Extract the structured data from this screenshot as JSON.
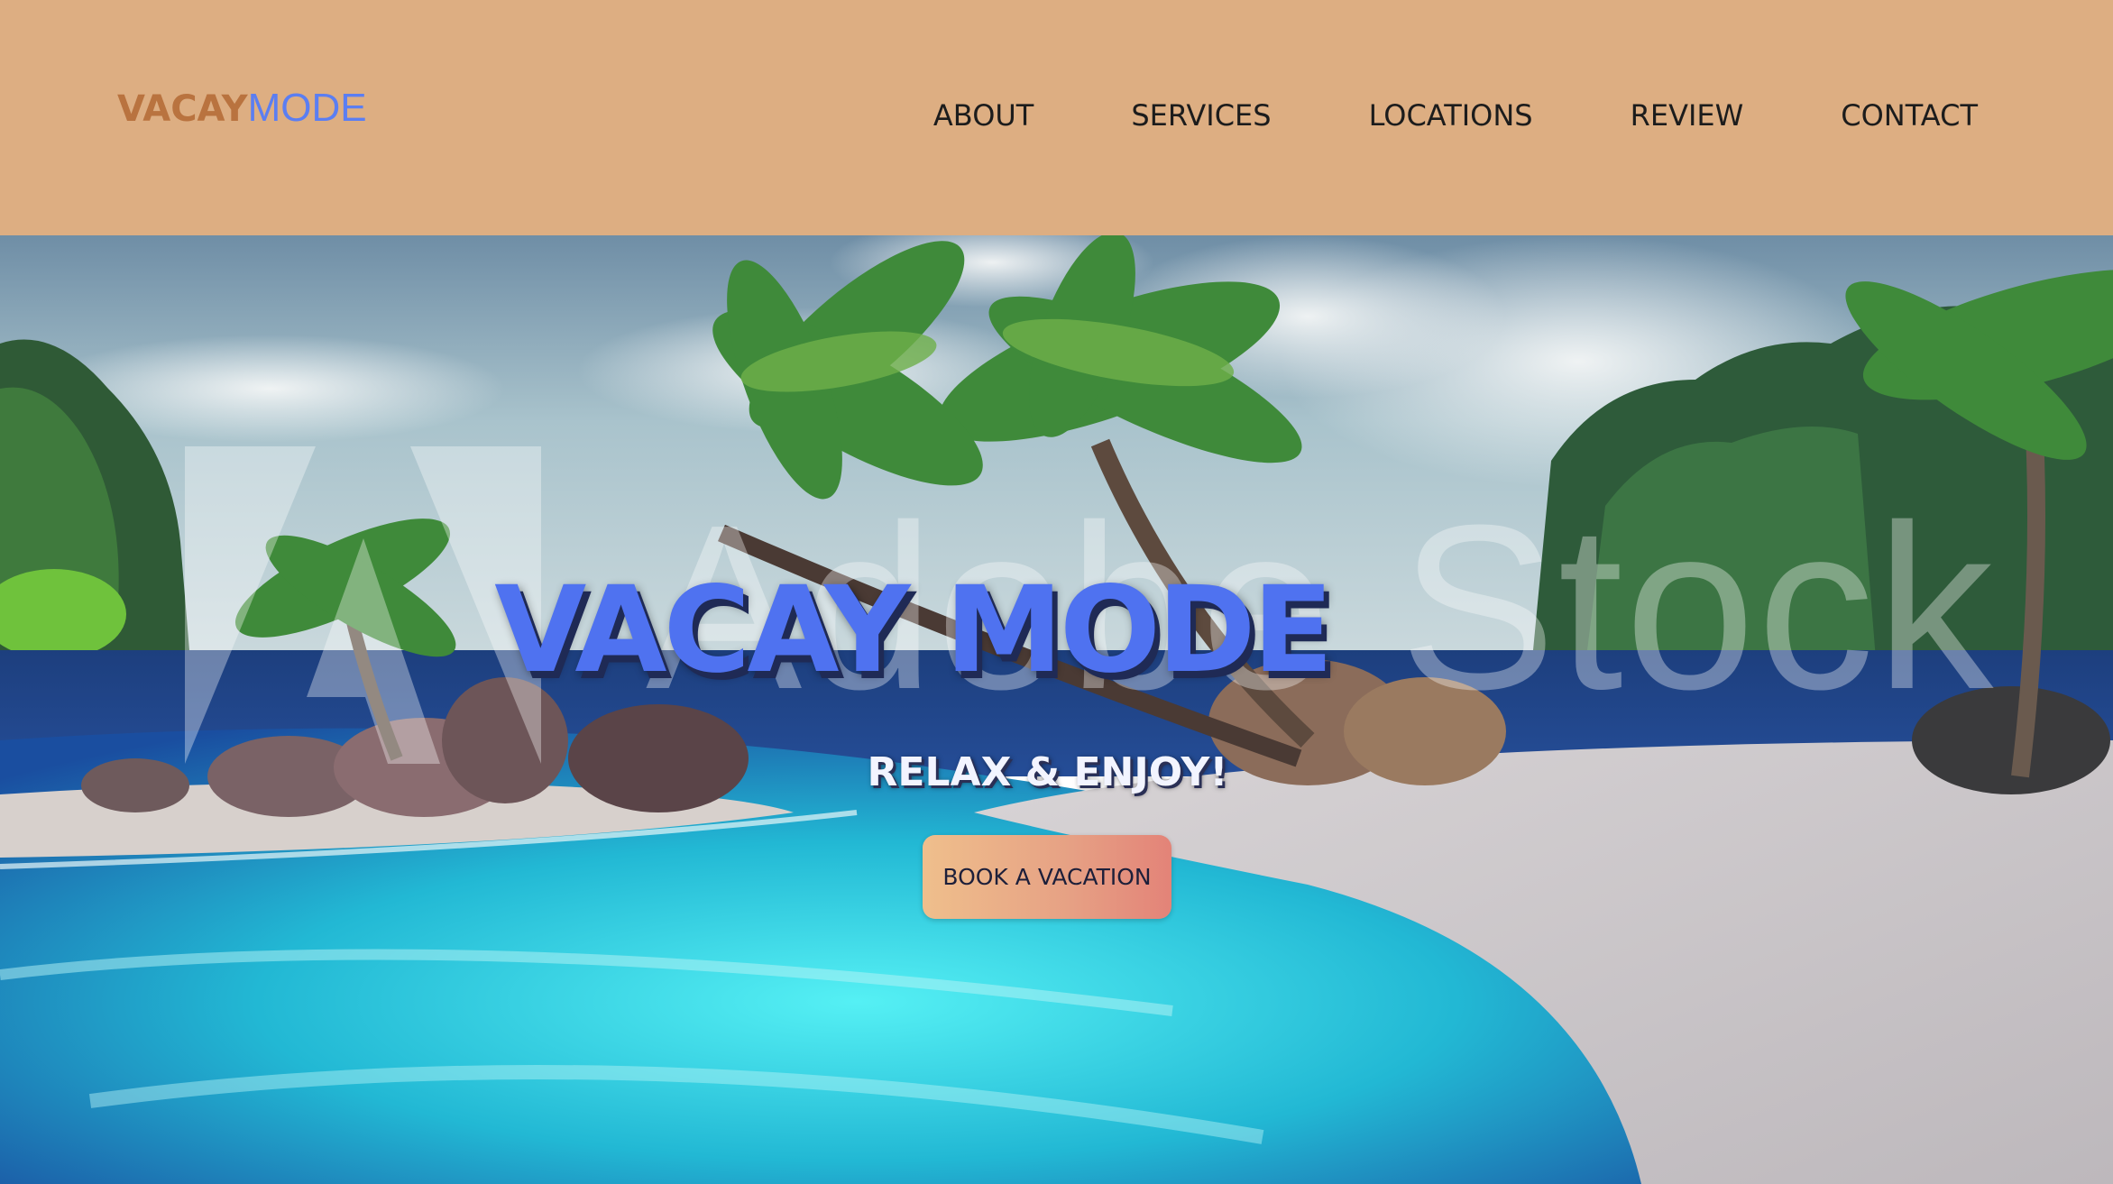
{
  "header": {
    "logo": {
      "part1": "VACAY",
      "part2": "MODE"
    },
    "nav": [
      {
        "label": "ABOUT"
      },
      {
        "label": "SERVICES"
      },
      {
        "label": "LOCATIONS"
      },
      {
        "label": "REVIEW"
      },
      {
        "label": "CONTACT"
      }
    ]
  },
  "hero": {
    "title": "VACAY MODE",
    "subtitle": "RELAX & ENJOY!",
    "cta_label": "BOOK A VACATION",
    "watermark": "Adobe Stock"
  },
  "colors": {
    "header_bg": "#ddae82",
    "logo_primary": "#b9733f",
    "logo_accent": "#5b7ef2",
    "title": "#4f72f0",
    "cta_start": "#efbf8c",
    "cta_end": "#e38378"
  }
}
